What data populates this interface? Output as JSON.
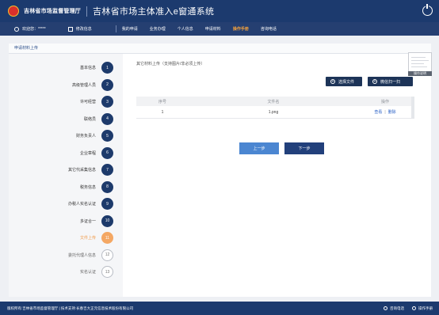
{
  "header": {
    "agency": "吉林省市场监督管理厅",
    "system_title": "吉林省市场主体准入e窗通系统"
  },
  "nav": {
    "welcome": "欢迎您：*****",
    "edit_info": "修改信息",
    "menu": [
      "我的申请",
      "业务办理",
      "个人信息",
      "申请材料",
      "操作手册",
      "咨询电话"
    ],
    "active_menu": "操作手册"
  },
  "panel": {
    "title": "申请材料上传"
  },
  "steps": [
    {
      "label": "基本信息",
      "num": "1",
      "state": "done"
    },
    {
      "label": "高级管理人员",
      "num": "2",
      "state": "done"
    },
    {
      "label": "许可经营",
      "num": "3",
      "state": "done"
    },
    {
      "label": "联络员",
      "num": "4",
      "state": "done"
    },
    {
      "label": "财务负责人",
      "num": "5",
      "state": "done"
    },
    {
      "label": "企业章程",
      "num": "6",
      "state": "done"
    },
    {
      "label": "其它代采集信息",
      "num": "7",
      "state": "done"
    },
    {
      "label": "税务信息",
      "num": "8",
      "state": "done"
    },
    {
      "label": "办税人实名认证",
      "num": "9",
      "state": "done"
    },
    {
      "label": "多证合一",
      "num": "10",
      "state": "done"
    },
    {
      "label": "文件上传",
      "num": "11",
      "state": "current"
    },
    {
      "label": "委托代理人信息",
      "num": "12",
      "state": "pending"
    },
    {
      "label": "实名认证",
      "num": "13",
      "state": "pending"
    }
  ],
  "upload": {
    "title": "其它材料上传（支持图片/非必须上传）",
    "choose_file": "选择文件",
    "scan_upload": "微信扫一扫",
    "columns": [
      "序号",
      "文件名",
      "操作"
    ],
    "rows": [
      {
        "index": "1",
        "filename": "1.png",
        "view": "查看",
        "delete": "删除"
      }
    ],
    "prev": "上一步",
    "next": "下一步"
  },
  "thumbnail": {
    "badge": "操作说明"
  },
  "footer": {
    "copyright": "版权所有:吉林省市场监督管理厅 | 技术支持:长春吉大正元信息技术股份有限公司",
    "consult_phone": "咨询电话",
    "manual": "操作手册"
  },
  "colors": {
    "header_bg": "#1c3a6e",
    "active_menu": "#f4a23d",
    "step_done": "#1d3a6b",
    "step_current": "#f4a763",
    "prev_button": "#4b86d1",
    "next_button": "#22407b"
  }
}
